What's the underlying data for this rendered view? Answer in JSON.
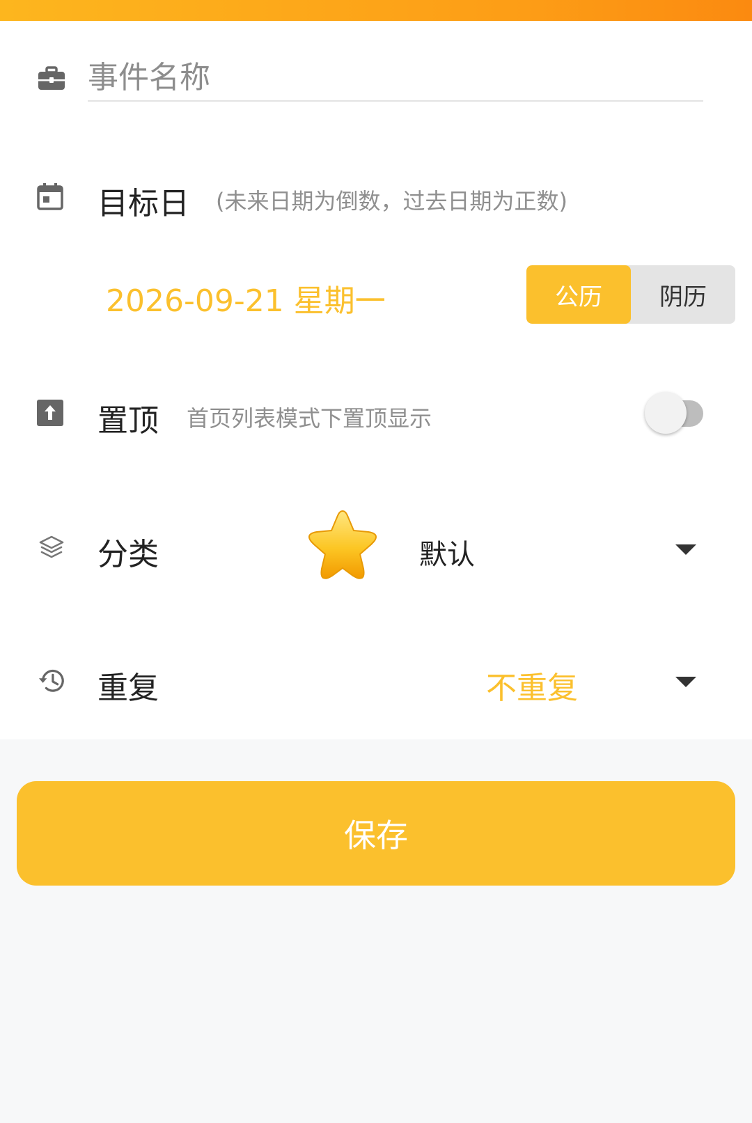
{
  "event_name": {
    "placeholder": "事件名称",
    "value": ""
  },
  "target_date": {
    "label": "目标日",
    "hint": "(未来日期为倒数，过去日期为正数)",
    "date_value": "2026-09-21 星期一",
    "calendar_options": [
      "公历",
      "阴历"
    ],
    "selected_calendar": "公历"
  },
  "pin_top": {
    "label": "置顶",
    "hint": "首页列表模式下置顶显示",
    "enabled": false
  },
  "category": {
    "label": "分类",
    "icon": "star-icon",
    "value": "默认"
  },
  "repeat": {
    "label": "重复",
    "value": "不重复"
  },
  "save_label": "保存",
  "colors": {
    "accent": "#fbc02d",
    "header": "#fd9d16",
    "background": "#f7f8f9",
    "hint": "#8f8f8f"
  },
  "icons": {
    "event_name": "briefcase-icon",
    "target_date": "calendar-icon",
    "pin_top": "pin-top-icon",
    "category": "layers-icon",
    "repeat": "history-icon"
  }
}
